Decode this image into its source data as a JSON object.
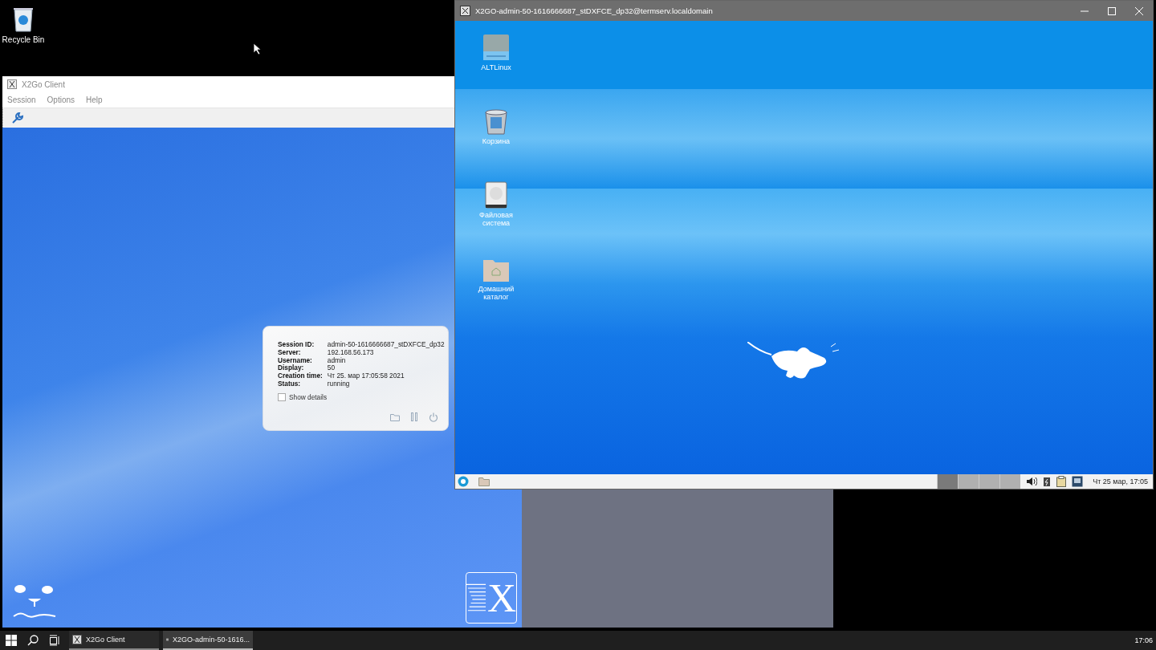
{
  "desktop": {
    "icons": [
      {
        "label": "Recycle Bin"
      }
    ]
  },
  "client_window": {
    "title": "X2Go Client",
    "menu": [
      "Session",
      "Options",
      "Help"
    ],
    "session": {
      "fields": [
        {
          "label": "Session ID:",
          "value": "admin-50-1616666687_stDXFCE_dp32"
        },
        {
          "label": "Server:",
          "value": "192.168.56.173"
        },
        {
          "label": "Username:",
          "value": "admin"
        },
        {
          "label": "Display:",
          "value": "50"
        },
        {
          "label": "Creation time:",
          "value": "Чт 25. мар 17:05:58 2021"
        },
        {
          "label": "Status:",
          "value": "running"
        }
      ],
      "show_details": {
        "label": "Show details",
        "checked": false
      }
    },
    "logo_letter": "X"
  },
  "remote_window": {
    "title": "X2GO-admin-50-1616666687_stDXFCE_dp32@termserv.localdomain",
    "icons": [
      {
        "kind": "drive",
        "label": "ALTLinux"
      },
      {
        "kind": "trash",
        "label": "Корзина"
      },
      {
        "kind": "disk",
        "label": "Файловая система"
      },
      {
        "kind": "home",
        "label": "Домашний каталог"
      }
    ],
    "panel": {
      "workspaces": [
        {
          "selected": true
        },
        {
          "selected": false
        },
        {
          "selected": false
        },
        {
          "selected": false
        }
      ],
      "clock": "Чт 25 мар, 17:05"
    }
  },
  "taskbar": {
    "items": [
      {
        "label": "X2Go Client",
        "selected": false
      },
      {
        "label": "X2GO-admin-50-1616...",
        "selected": true
      }
    ],
    "clock": "17:06"
  }
}
